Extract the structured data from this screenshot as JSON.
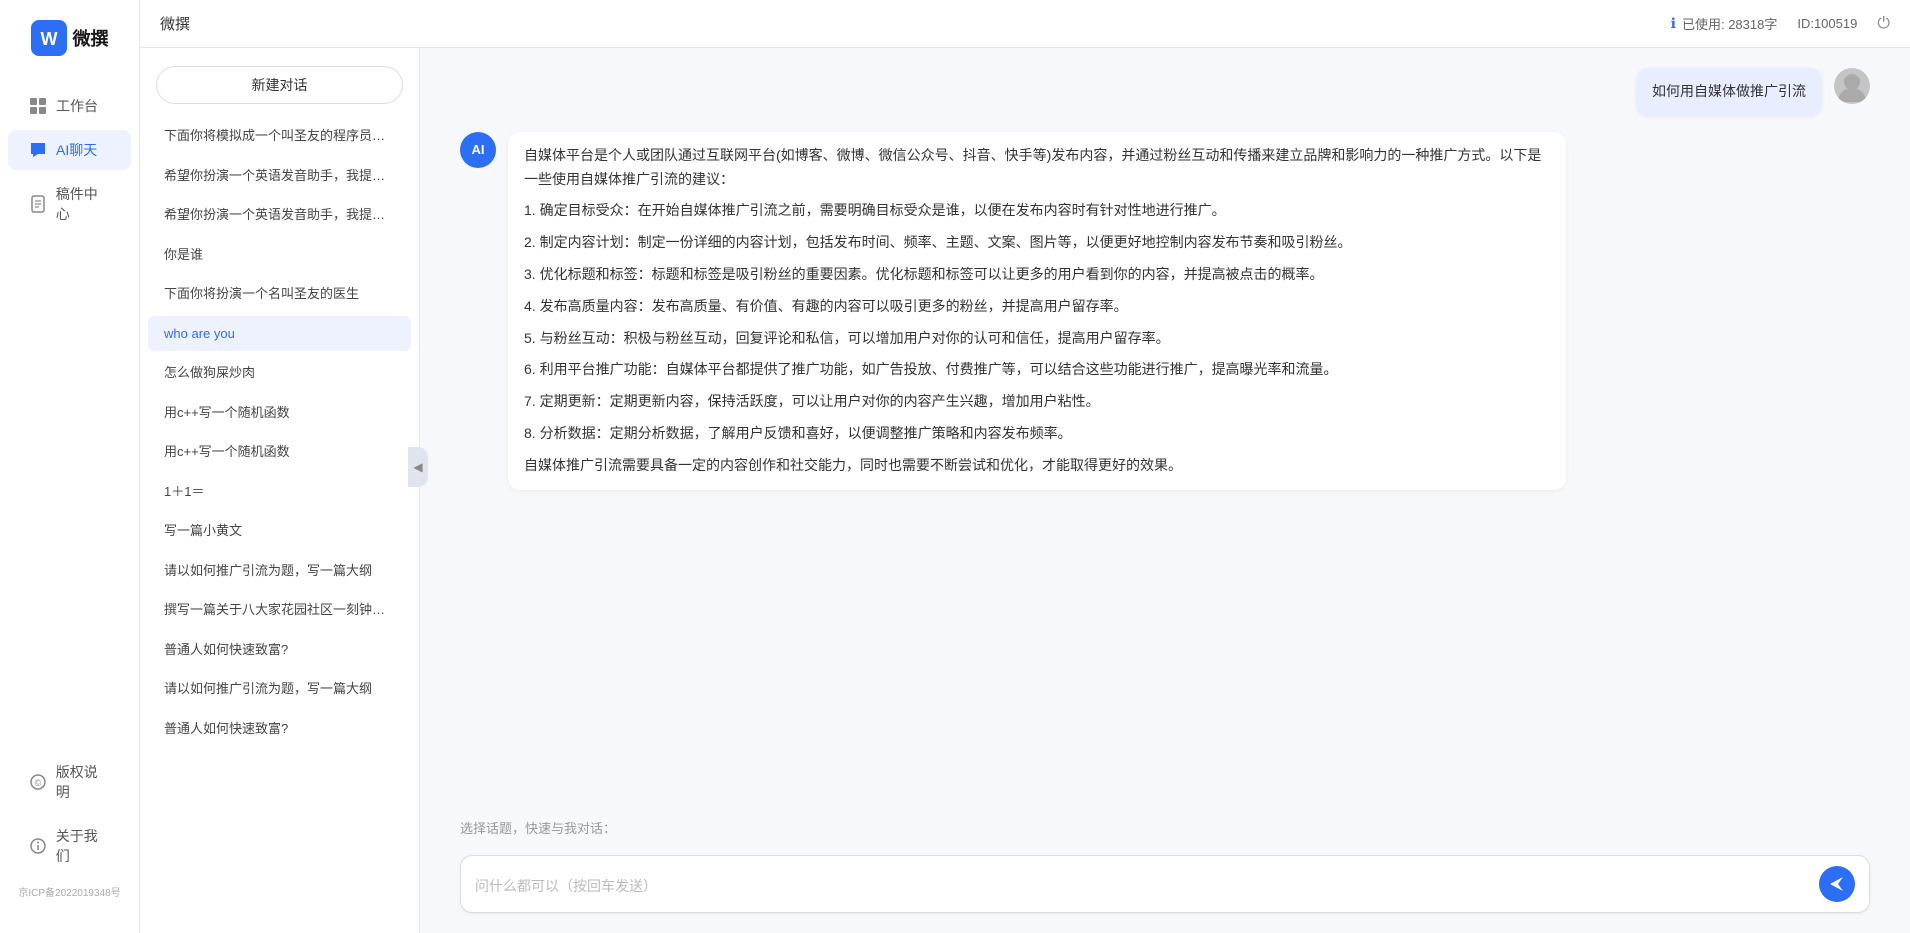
{
  "app": {
    "title": "微撰",
    "logo_letter": "W",
    "usage_label": "已使用: 28318字",
    "usage_icon": "ℹ",
    "id_label": "ID:100519",
    "power_icon": "⏻"
  },
  "nav": {
    "items": [
      {
        "id": "workbench",
        "label": "工作台",
        "icon": "grid",
        "active": false
      },
      {
        "id": "ai-chat",
        "label": "AI聊天",
        "icon": "chat",
        "active": true
      },
      {
        "id": "drafts",
        "label": "稿件中心",
        "icon": "file",
        "active": false
      }
    ],
    "bottom": [
      {
        "id": "copyright",
        "label": "版权说明",
        "icon": "copyright"
      },
      {
        "id": "about",
        "label": "关于我们",
        "icon": "info"
      }
    ],
    "icp": "京ICP备2022019348号"
  },
  "chat_list": {
    "new_chat_label": "新建对话",
    "items": [
      {
        "id": 1,
        "text": "下面你将模拟成一个叫圣友的程序员，我说...",
        "active": false
      },
      {
        "id": 2,
        "text": "希望你扮演一个英语发音助手，我提供给你...",
        "active": false
      },
      {
        "id": 3,
        "text": "希望你扮演一个英语发音助手，我提供给你...",
        "active": false
      },
      {
        "id": 4,
        "text": "你是谁",
        "active": false
      },
      {
        "id": 5,
        "text": "下面你将扮演一个名叫圣友的医生",
        "active": false
      },
      {
        "id": 6,
        "text": "who are you",
        "active": true
      },
      {
        "id": 7,
        "text": "怎么做狗屎炒肉",
        "active": false
      },
      {
        "id": 8,
        "text": "用c++写一个随机函数",
        "active": false
      },
      {
        "id": 9,
        "text": "用c++写一个随机函数",
        "active": false
      },
      {
        "id": 10,
        "text": "1＋1＝",
        "active": false
      },
      {
        "id": 11,
        "text": "写一篇小黄文",
        "active": false
      },
      {
        "id": 12,
        "text": "请以如何推广引流为题，写一篇大纲",
        "active": false
      },
      {
        "id": 13,
        "text": "撰写一篇关于八大家花园社区一刻钟便民生...",
        "active": false
      },
      {
        "id": 14,
        "text": "普通人如何快速致富?",
        "active": false
      },
      {
        "id": 15,
        "text": "请以如何推广引流为题，写一篇大纲",
        "active": false
      },
      {
        "id": 16,
        "text": "普通人如何快速致富?",
        "active": false
      }
    ]
  },
  "chat": {
    "user_message": "如何用自媒体做推广引流",
    "ai_response": {
      "paragraphs": [
        "自媒体平台是个人或团队通过互联网平台(如博客、微博、微信公众号、抖音、快手等)发布内容，并通过粉丝互动和传播来建立品牌和影响力的一种推广方式。以下是一些使用自媒体推广引流的建议：",
        "1. 确定目标受众：在开始自媒体推广引流之前，需要明确目标受众是谁，以便在发布内容时有针对性地进行推广。",
        "2. 制定内容计划：制定一份详细的内容计划，包括发布时间、频率、主题、文案、图片等，以便更好地控制内容发布节奏和吸引粉丝。",
        "3. 优化标题和标签：标题和标签是吸引粉丝的重要因素。优化标题和标签可以让更多的用户看到你的内容，并提高被点击的概率。",
        "4. 发布高质量内容：发布高质量、有价值、有趣的内容可以吸引更多的粉丝，并提高用户留存率。",
        "5. 与粉丝互动：积极与粉丝互动，回复评论和私信，可以增加用户对你的认可和信任，提高用户留存率。",
        "6. 利用平台推广功能：自媒体平台都提供了推广功能，如广告投放、付费推广等，可以结合这些功能进行推广，提高曝光率和流量。",
        "7. 定期更新：定期更新内容，保持活跃度，可以让用户对你的内容产生兴趣，增加用户粘性。",
        "8. 分析数据：定期分析数据，了解用户反馈和喜好，以便调整推广策略和内容发布频率。",
        "自媒体推广引流需要具备一定的内容创作和社交能力，同时也需要不断尝试和优化，才能取得更好的效果。"
      ]
    },
    "suggestions_label": "选择话题，快速与我对话：",
    "input_placeholder": "问什么都可以（按回车发送）",
    "send_icon": "➤"
  }
}
